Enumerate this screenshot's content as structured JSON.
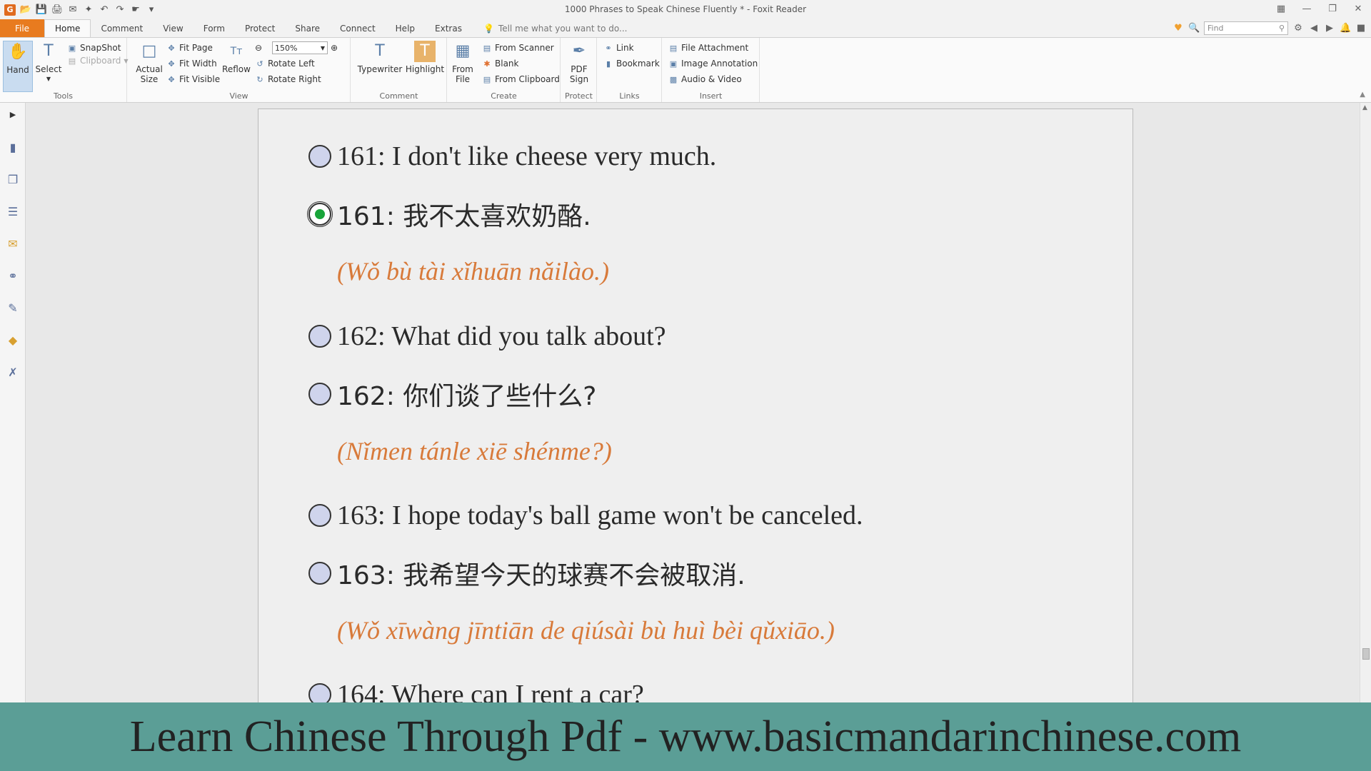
{
  "window": {
    "title": "1000 Phrases to Speak Chinese Fluently * - Foxit Reader",
    "app_icon": "G"
  },
  "tabs": [
    {
      "label": "File"
    },
    {
      "label": "Home"
    },
    {
      "label": "Comment"
    },
    {
      "label": "View"
    },
    {
      "label": "Form"
    },
    {
      "label": "Protect"
    },
    {
      "label": "Share"
    },
    {
      "label": "Connect"
    },
    {
      "label": "Help"
    },
    {
      "label": "Extras"
    }
  ],
  "tell_me": "Tell me what you want to do...",
  "find": {
    "placeholder": "Find"
  },
  "ribbon": {
    "tools": {
      "label": "Tools",
      "hand": "Hand",
      "select": "Select",
      "snapshot": "SnapShot",
      "clipboard": "Clipboard"
    },
    "view": {
      "label": "View",
      "actual_size_1": "Actual",
      "actual_size_2": "Size",
      "fit_page": "Fit Page",
      "fit_width": "Fit Width",
      "fit_visible": "Fit Visible",
      "reflow": "Reflow",
      "zoom": "150%",
      "rotate_left": "Rotate Left",
      "rotate_right": "Rotate Right"
    },
    "comment": {
      "label": "Comment",
      "typewriter": "Typewriter",
      "highlight": "Highlight"
    },
    "create": {
      "label": "Create",
      "from_file_1": "From",
      "from_file_2": "File",
      "from_scanner": "From Scanner",
      "blank": "Blank",
      "from_clipboard": "From Clipboard"
    },
    "protect": {
      "label": "Protect",
      "pdf_sign_1": "PDF",
      "pdf_sign_2": "Sign"
    },
    "links": {
      "label": "Links",
      "link": "Link",
      "bookmark": "Bookmark"
    },
    "insert": {
      "label": "Insert",
      "file_attachment": "File Attachment",
      "image_annotation": "Image Annotation",
      "audio_video": "Audio & Video"
    }
  },
  "document": {
    "lines": [
      {
        "text": "161: I don't like cheese very much.",
        "checked": false
      },
      {
        "text": "161: 我不太喜欢奶酪.",
        "checked": true
      },
      {
        "pinyin": "(Wǒ bù tài xǐhuān nǎilào.)"
      },
      {
        "text": "162: What did you talk about?",
        "checked": false
      },
      {
        "text": "162: 你们谈了些什么?",
        "checked": false
      },
      {
        "pinyin": "(Nǐmen tánle xiē shénme?)"
      },
      {
        "text": "163: I hope today's ball game won't be canceled.",
        "checked": false
      },
      {
        "text": "163: 我希望今天的球赛不会被取消.",
        "checked": false
      },
      {
        "pinyin": "(Wǒ xīwàng jīntiān de qiúsài bù huì bèi qǔxiāo.)"
      },
      {
        "text": "164: Where can I rent a car?",
        "checked": false
      }
    ]
  },
  "banner": {
    "text": "Learn Chinese Through Pdf - www.basicmandarinchinese.com"
  },
  "colors": {
    "file_tab": "#e87b1f",
    "banner": "#5b9e96",
    "pinyin": "#d87a3a",
    "radio_fill": "#cfd4ec",
    "radio_checked": "#19a53a"
  }
}
